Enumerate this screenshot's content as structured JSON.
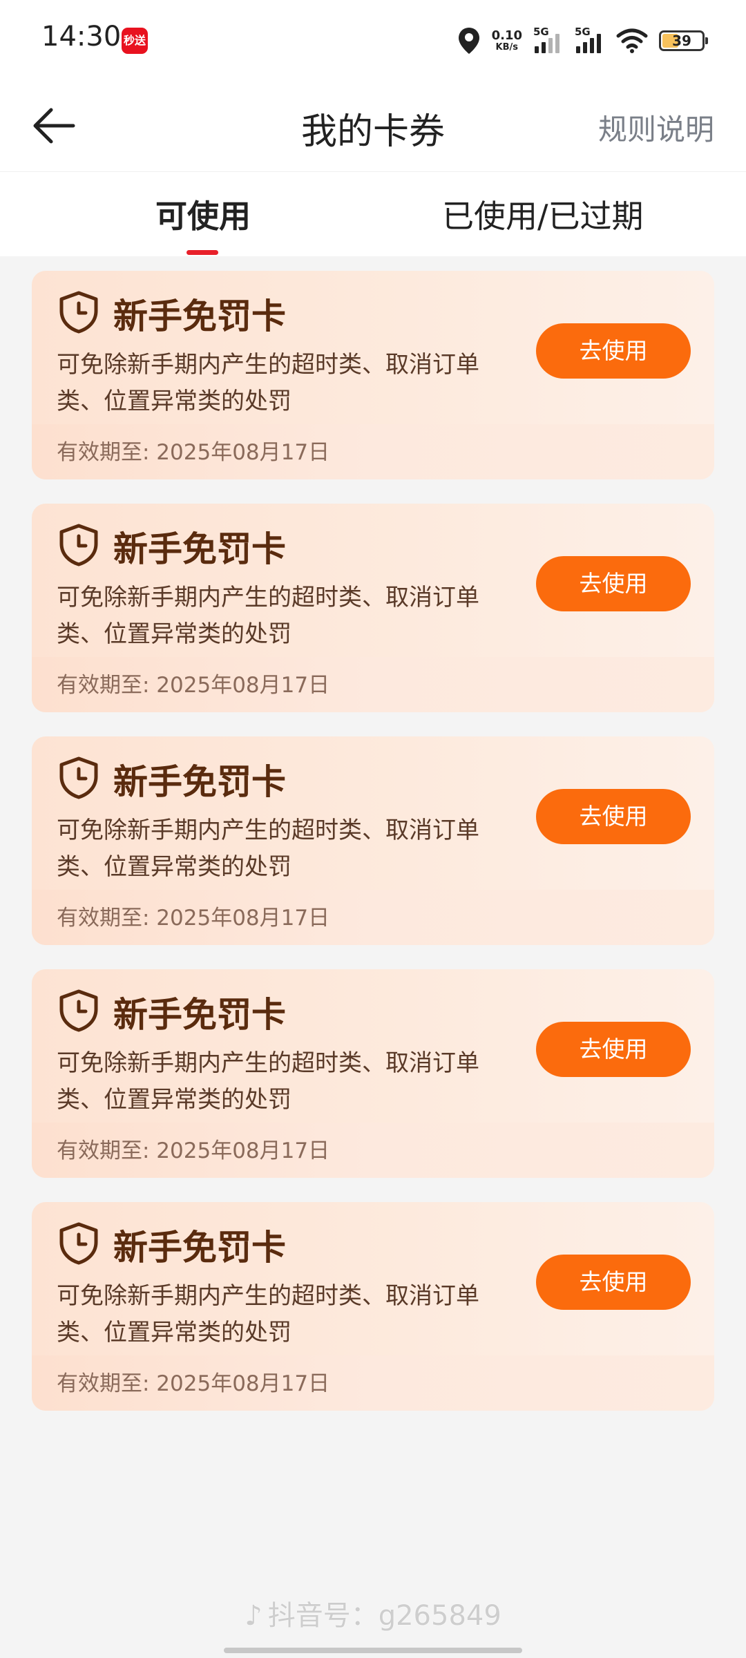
{
  "status_bar": {
    "time": "14:30",
    "app_badge": "秒送",
    "net_speed_value": "0.10",
    "net_speed_unit": "KB/s",
    "signal1_label": "5G",
    "signal2_label": "5G",
    "battery_level": "39",
    "icons": [
      "location-icon",
      "wifi-icon",
      "battery-icon"
    ]
  },
  "header": {
    "title": "我的卡券",
    "rules_link": "规则说明",
    "back_icon": "arrow-left-icon"
  },
  "tabs": [
    {
      "label": "可使用",
      "active": true
    },
    {
      "label": "已使用/已过期",
      "active": false
    }
  ],
  "coupons": [
    {
      "title": "新手免罚卡",
      "description": "可免除新手期内产生的超时类、取消订单类、位置异常类的处罚",
      "expiry": "有效期至: 2025年08月17日",
      "button_label": "去使用"
    },
    {
      "title": "新手免罚卡",
      "description": "可免除新手期内产生的超时类、取消订单类、位置异常类的处罚",
      "expiry": "有效期至: 2025年08月17日",
      "button_label": "去使用"
    },
    {
      "title": "新手免罚卡",
      "description": "可免除新手期内产生的超时类、取消订单类、位置异常类的处罚",
      "expiry": "有效期至: 2025年08月17日",
      "button_label": "去使用"
    },
    {
      "title": "新手免罚卡",
      "description": "可免除新手期内产生的超时类、取消订单类、位置异常类的处罚",
      "expiry": "有效期至: 2025年08月17日",
      "button_label": "去使用"
    },
    {
      "title": "新手免罚卡",
      "description": "可免除新手期内产生的超时类、取消订单类、位置异常类的处罚",
      "expiry": "有效期至: 2025年08月17日",
      "button_label": "去使用"
    }
  ],
  "watermark": "抖音号：g265849",
  "colors": {
    "accent": "#fb6b0d",
    "tab_indicator": "#e8202a",
    "coupon_title": "#5a2b0e",
    "coupon_bg": "#fde3d3"
  }
}
